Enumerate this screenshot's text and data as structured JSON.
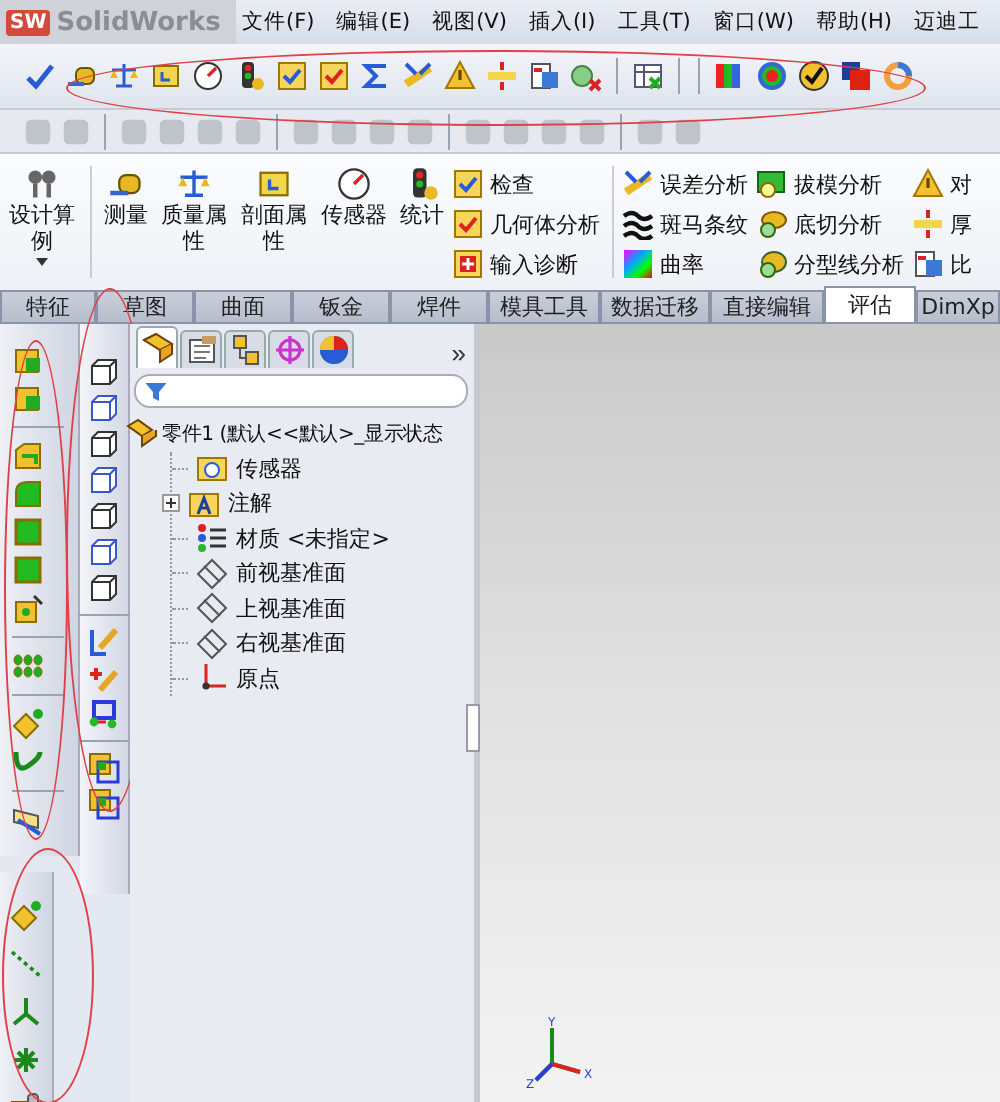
{
  "title_bar": {
    "logo_mark": "SW",
    "app_name": "SolidWorks"
  },
  "menu": [
    {
      "label": "文件(F)"
    },
    {
      "label": "编辑(E)"
    },
    {
      "label": "视图(V)"
    },
    {
      "label": "插入(I)"
    },
    {
      "label": "工具(T)"
    },
    {
      "label": "窗口(W)"
    },
    {
      "label": "帮助(H)"
    },
    {
      "label": "迈迪工"
    }
  ],
  "main_toolbar": {
    "circled": true
  },
  "standard_toolbar": {
    "disabled": true
  },
  "command_manager": {
    "large_buttons": [
      {
        "label": "设计算例",
        "has_dropdown": true
      },
      {
        "label": "测量",
        "has_dropdown": false
      },
      {
        "label": "质量属性",
        "has_dropdown": false
      },
      {
        "label": "剖面属性",
        "has_dropdown": false
      },
      {
        "label": "传感器",
        "has_dropdown": false
      },
      {
        "label": "统计",
        "has_dropdown": false
      }
    ],
    "columns": [
      [
        {
          "label": "检查"
        },
        {
          "label": "几何体分析"
        },
        {
          "label": "输入诊断"
        }
      ],
      [
        {
          "label": "误差分析"
        },
        {
          "label": "斑马条纹"
        },
        {
          "label": "曲率"
        }
      ],
      [
        {
          "label": "拔模分析"
        },
        {
          "label": "底切分析"
        },
        {
          "label": "分型线分析"
        }
      ],
      [
        {
          "label": "对"
        },
        {
          "label": "厚"
        },
        {
          "label": "比"
        }
      ]
    ]
  },
  "tabs": [
    {
      "label": "特征",
      "selected": false
    },
    {
      "label": "草图",
      "selected": false
    },
    {
      "label": "曲面",
      "selected": false
    },
    {
      "label": "钣金",
      "selected": false
    },
    {
      "label": "焊件",
      "selected": false
    },
    {
      "label": "模具工具",
      "selected": false
    },
    {
      "label": "数据迁移",
      "selected": false
    },
    {
      "label": "直接编辑",
      "selected": false
    },
    {
      "label": "评估",
      "selected": true
    },
    {
      "label": "DimXp",
      "selected": false
    }
  ],
  "left_toolbars": {
    "features_circled": true,
    "sketch_circled": true,
    "reference_circled": true
  },
  "feature_manager": {
    "tabs": [
      {
        "selected": true
      },
      {
        "selected": false
      },
      {
        "selected": false
      },
      {
        "selected": false
      },
      {
        "selected": false
      }
    ],
    "more": "»",
    "tree": [
      {
        "label": "零件1  (默认<<默认>_显示状态",
        "children": [
          {
            "label": "传感器"
          },
          {
            "label": "注解",
            "expanded": false
          },
          {
            "label": "材质 <未指定>"
          },
          {
            "label": "前视基准面"
          },
          {
            "label": "上视基准面"
          },
          {
            "label": "右视基准面"
          },
          {
            "label": "原点"
          }
        ]
      }
    ]
  },
  "graphics_area": {
    "triad_labels": [
      "Y",
      "X",
      "Z"
    ]
  }
}
